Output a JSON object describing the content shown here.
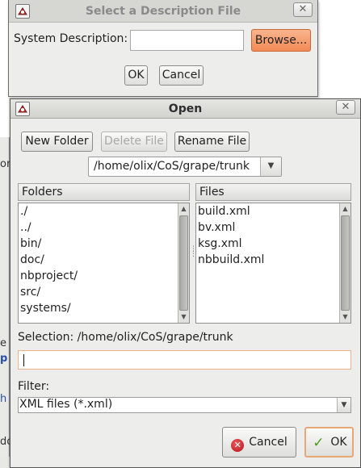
{
  "background": {
    "fragments": [
      "on",
      "e",
      "p",
      "h",
      "do"
    ]
  },
  "description_dialog": {
    "title": "Select a Description File",
    "close_icon": "close-icon",
    "system_description_label": "System Description:",
    "system_description_value": "",
    "browse_label": "Browse...",
    "ok_label": "OK",
    "cancel_label": "Cancel"
  },
  "open_dialog": {
    "title": "Open",
    "close_icon": "close-icon",
    "toolbar": {
      "new_folder": "New Folder",
      "delete_file": "Delete File",
      "rename_file": "Rename File"
    },
    "path": "/home/olix/CoS/grape/trunk",
    "folders_header": "Folders",
    "folders": [
      "./",
      "../",
      "bin/",
      "doc/",
      "nbproject/",
      "src/",
      "systems/"
    ],
    "files_header": "Files",
    "files": [
      "build.xml",
      "bv.xml",
      "ksg.xml",
      "nbbuild.xml"
    ],
    "selection_label": "Selection: /home/olix/CoS/grape/trunk",
    "selection_value": "",
    "filter_label": "Filter:",
    "filter_value": "XML files (*.xml)",
    "cancel_label": "Cancel",
    "ok_label": "OK",
    "colors": {
      "accent_orange": "#f28a55",
      "ok_border": "#e7a777",
      "cancel_icon": "#c4161c",
      "ok_icon": "#4f9a21"
    }
  }
}
